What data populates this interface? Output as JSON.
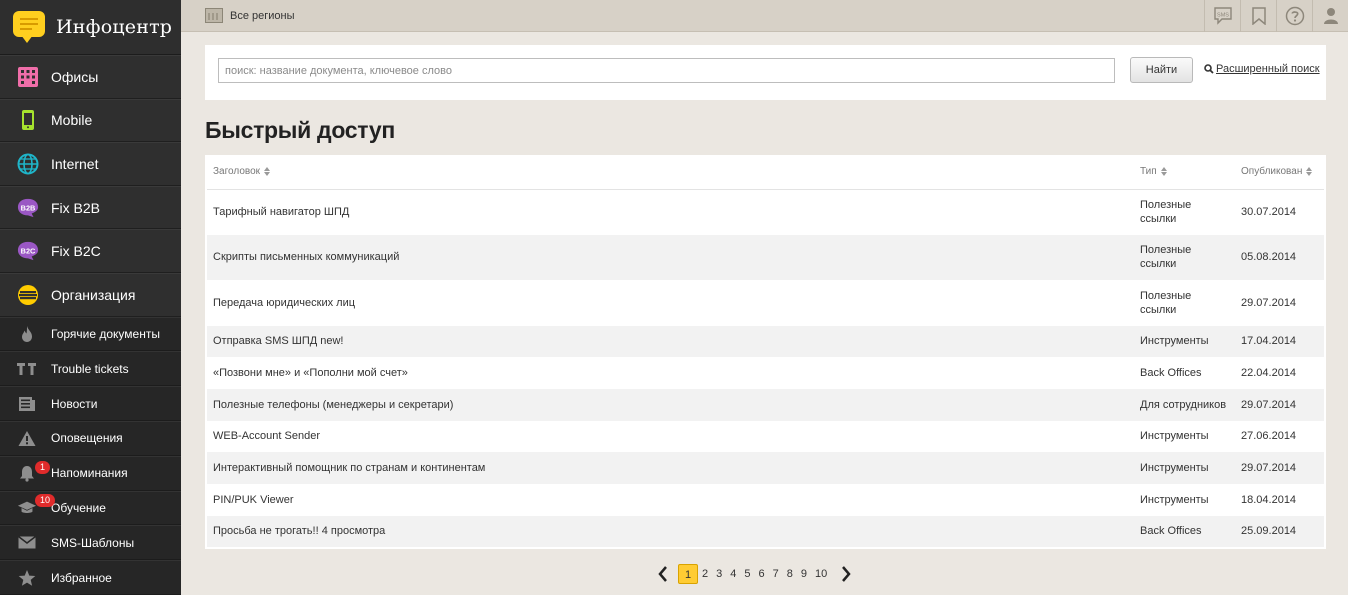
{
  "app": {
    "title": "Инфоцентр"
  },
  "sidebar": {
    "main": [
      {
        "label": "Офисы",
        "icon": "offices-icon"
      },
      {
        "label": "Mobile",
        "icon": "mobile-icon"
      },
      {
        "label": "Internet",
        "icon": "globe-icon"
      },
      {
        "label": "Fix B2B",
        "icon": "b2b-icon"
      },
      {
        "label": "Fix B2C",
        "icon": "b2c-icon"
      },
      {
        "label": "Организация",
        "icon": "organization-icon"
      }
    ],
    "sub": [
      {
        "label": "Горячие документы",
        "icon": "flame-icon"
      },
      {
        "label": "Trouble tickets",
        "icon": "tt-icon"
      },
      {
        "label": "Новости",
        "icon": "news-icon"
      },
      {
        "label": "Оповещения",
        "icon": "warning-icon"
      },
      {
        "label": "Напоминания",
        "icon": "bell-icon",
        "badge": "1"
      },
      {
        "label": "Обучение",
        "icon": "graduation-cap-icon",
        "badge": "10"
      },
      {
        "label": "SMS-Шаблоны",
        "icon": "envelope-icon"
      },
      {
        "label": "Избранное",
        "icon": "star-icon"
      }
    ]
  },
  "topbar": {
    "region": "Все регионы",
    "icons": [
      "sms-icon",
      "bookmark-icon",
      "help-icon",
      "user-icon"
    ],
    "sms_text": "SMS"
  },
  "search": {
    "placeholder": "поиск: название документа, ключевое слово",
    "button": "Найти",
    "advanced": "Расширенный поиск"
  },
  "main": {
    "title": "Быстрый доступ",
    "columns": {
      "title": "Заголовок",
      "type": "Тип",
      "published": "Опубликован"
    },
    "rows": [
      {
        "title": "Тарифный навигатор ШПД",
        "type_line1": "Полезные",
        "type_line2": "ссылки",
        "date": "30.07.2014"
      },
      {
        "title": "Скрипты письменных коммуникаций",
        "type_line1": "Полезные",
        "type_line2": "ссылки",
        "date": "05.08.2014"
      },
      {
        "title": "Передача юридических лиц",
        "type_line1": "Полезные",
        "type_line2": "ссылки",
        "date": "29.07.2014"
      },
      {
        "title": "Отправка SMS ШПД new!",
        "type": "Инструменты",
        "date": "17.04.2014"
      },
      {
        "title": "«Позвони мне» и «Пополни мой счет»",
        "type": "Back Offices",
        "date": "22.04.2014"
      },
      {
        "title": "Полезные телефоны (менеджеры и секретари)",
        "type": "Для сотрудников",
        "date": "29.07.2014"
      },
      {
        "title": "WEB-Account Sender",
        "type": "Инструменты",
        "date": "27.06.2014"
      },
      {
        "title": "Интерактивный помощник по странам и континентам",
        "type": "Инструменты",
        "date": "29.07.2014"
      },
      {
        "title": "PIN/PUK Viewer",
        "type": "Инструменты",
        "date": "18.04.2014"
      },
      {
        "title": "Просьба не трогать!! 4 просмотра",
        "type": "Back Offices",
        "date": "25.09.2014"
      }
    ]
  },
  "pagination": {
    "pages": [
      "1",
      "2",
      "3",
      "4",
      "5",
      "6",
      "7",
      "8",
      "9",
      "10"
    ],
    "current": "1"
  },
  "colors": {
    "sidebar_bg": "#2b2b2b",
    "brand_yellow": "#ffcf1f",
    "offices_pink": "#f06ea9",
    "mobile_green": "#a6e22e",
    "internet_teal": "#1fb5c9",
    "b2b_purple": "#9a57c4",
    "org_yellow": "#ffcc00",
    "badge_red": "#e02b2b",
    "page_bg": "#ebe7e1",
    "topbar_bg": "#d7d1c7",
    "pager_active": "#ffcc33"
  }
}
